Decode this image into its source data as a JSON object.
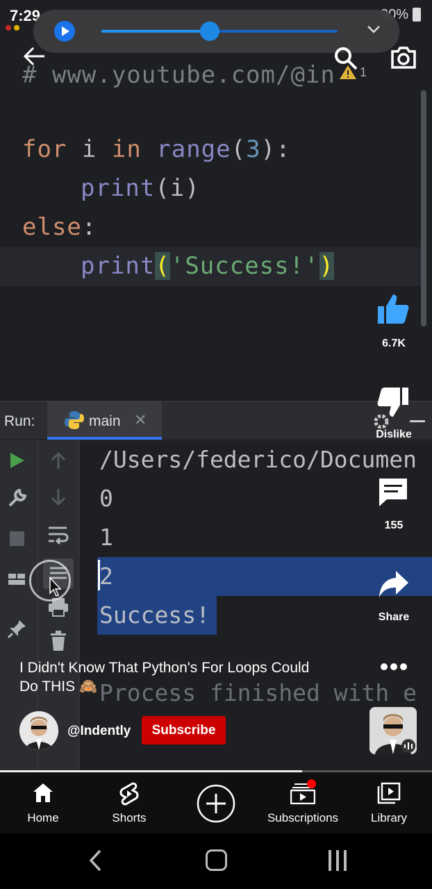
{
  "status_bar": {
    "time": "7:29",
    "battery": "90%"
  },
  "player": {
    "progress": 0.46
  },
  "code": {
    "comment": "# www.youtube.com/@in",
    "warning_count": "1",
    "line1": {
      "kw_for": "for",
      "var": " i ",
      "kw_in": "in",
      "fn": " range",
      "open": "(",
      "num": "3",
      "close": "):"
    },
    "line2": {
      "fn": "print",
      "args": "(i)"
    },
    "line3": {
      "kw": "else",
      "colon": ":"
    },
    "line4": {
      "fn": "print",
      "open": "(",
      "str": "'Success!'",
      "close": ")"
    }
  },
  "run_panel": {
    "label": "Run:",
    "tab": "main",
    "output": [
      "/Users/federico/Documen",
      "0",
      "1",
      "2",
      "Success!",
      "Process finished with e"
    ]
  },
  "actions": {
    "like_count": "6.7K",
    "dislike_label": "Dislike",
    "comments_count": "155",
    "share_label": "Share"
  },
  "video": {
    "title": "I Didn't Know That Python's For Loops Could Do THIS 🙈",
    "channel": "@Indently",
    "subscribe": "Subscribe",
    "progress": 0.7
  },
  "bottom_nav": {
    "home": "Home",
    "shorts": "Shorts",
    "subscriptions": "Subscriptions",
    "library": "Library"
  }
}
